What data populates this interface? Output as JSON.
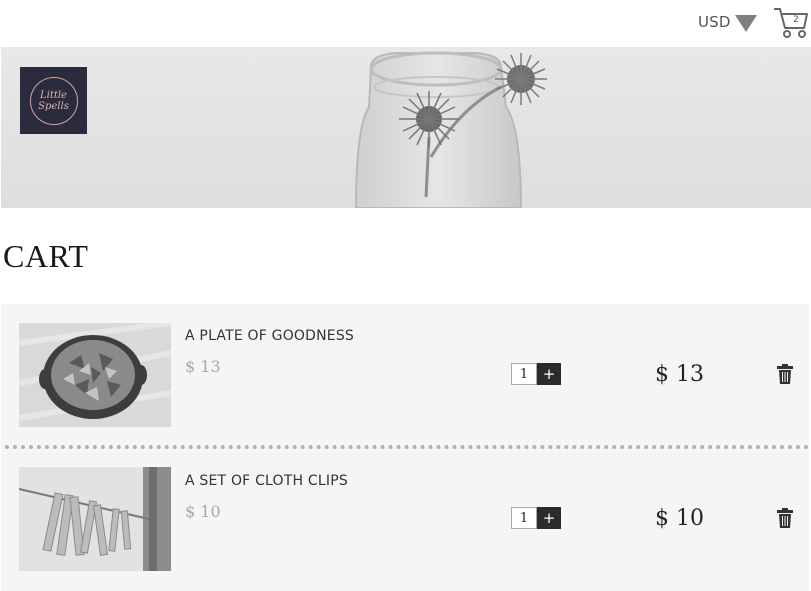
{
  "header": {
    "currency": "USD",
    "currency_icon": "triangle-down-icon",
    "cart_icon": "shopping-cart-icon",
    "cart_count": "2"
  },
  "banner": {
    "image": "flowers-in-glass-jar-photo",
    "logo": {
      "text": "Little\nSpells",
      "background": "#2a2b3d",
      "accent": "#d9a3a3"
    }
  },
  "page": {
    "title": "CART"
  },
  "cart": {
    "items": [
      {
        "name": "A PLATE OF GOODNESS",
        "unit_price": "$ 13",
        "quantity": "1",
        "plus": "+",
        "total": "$ 13",
        "image": "plate-of-food-photo"
      },
      {
        "name": "A SET OF CLOTH CLIPS",
        "unit_price": "$ 10",
        "quantity": "1",
        "plus": "+",
        "total": "$ 10",
        "image": "cloth-clips-photo"
      }
    ]
  },
  "colors": {
    "list_background": "#f5f5f5",
    "button_dark": "#2b2b2b",
    "muted_price": "#a8a8a8"
  }
}
